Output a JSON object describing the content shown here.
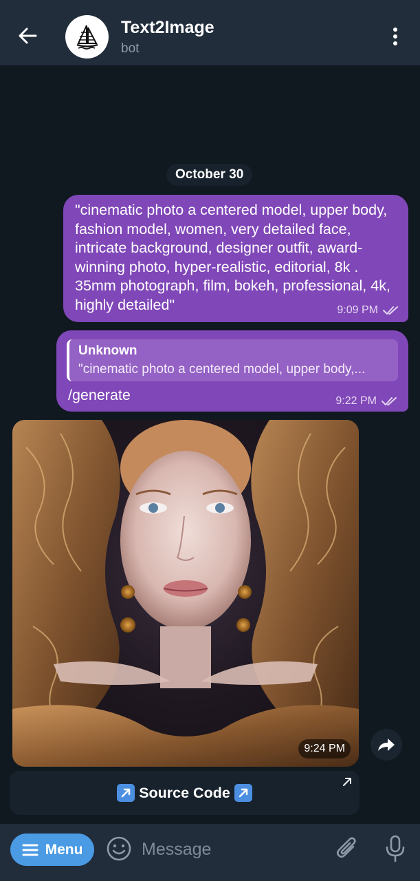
{
  "header": {
    "title": "Text2Image",
    "subtitle": "bot"
  },
  "chat": {
    "date_chip": "October 30",
    "messages": [
      {
        "text": "\"cinematic photo a centered model, upper body, fashion model, women, very detailed face, intricate background, designer outfit, award-winning photo, hyper-realistic, editorial, 8k . 35mm photograph, film, bokeh, professional, 4k, highly detailed\"",
        "time": "9:09 PM",
        "status_icon": "double-check-icon"
      },
      {
        "reply_author": "Unknown",
        "reply_text": "\"cinematic photo a centered model, upper body,...",
        "text": "/generate",
        "time": "9:22 PM",
        "status_icon": "double-check-icon"
      },
      {
        "type": "image",
        "time": "9:24 PM"
      }
    ],
    "source_button_label": "Source Code"
  },
  "input_bar": {
    "menu_label": "Menu",
    "placeholder": "Message"
  },
  "colors": {
    "header_bg": "#212d3b",
    "chat_bg": "#101820",
    "outgoing_bubble": "#8047b8",
    "menu_button": "#4a9be4"
  }
}
